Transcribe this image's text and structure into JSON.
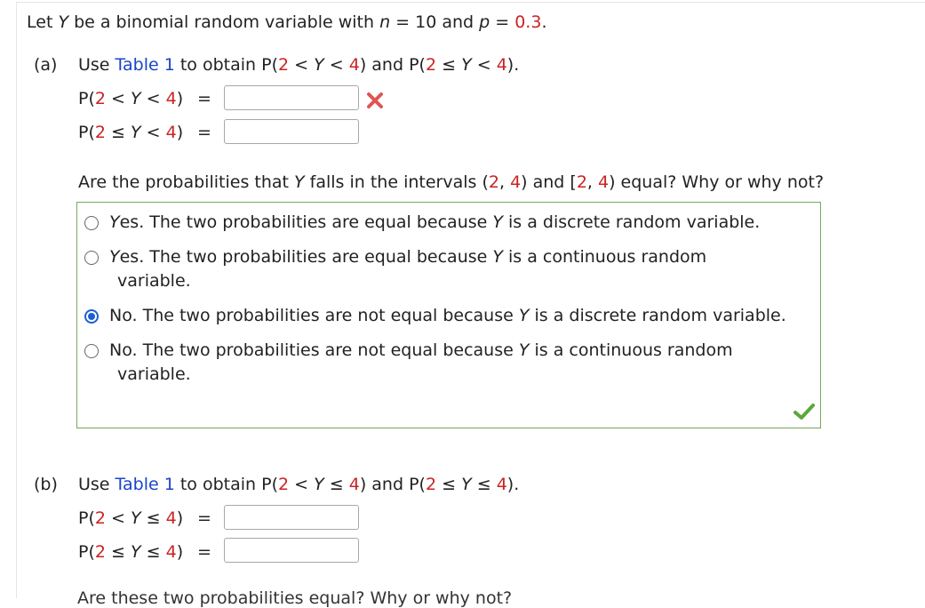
{
  "intro": {
    "t1": "Let ",
    "y": "Y",
    "t2": " be a binomial random variable with ",
    "n": "n",
    "eq1": " = ",
    "n_val": "10",
    "and": " and ",
    "p": "p",
    "eq2": " = ",
    "p_val": "0.3",
    "end": "."
  },
  "part_a": {
    "label": "(a)",
    "use": "Use ",
    "table_link": "Table 1",
    "obtain": " to obtain ",
    "expr1": "P(2 < Y < 4)",
    "and": " and ",
    "expr2": "P(2 ≤ Y < 4)",
    "period": ".",
    "row1": {
      "label": "P(2 < Y < 4)",
      "equals": "=",
      "value": "",
      "status": "incorrect"
    },
    "row2": {
      "label": "P(2 ≤ Y < 4)",
      "equals": "=",
      "value": ""
    },
    "question": "Are the probabilities that Y falls in the intervals (2, 4) and [2, 4) equal? Why or why not?",
    "choices": [
      {
        "text": "Yes. The two probabilities are equal because Y is a discrete random variable.",
        "cont": "",
        "selected": false
      },
      {
        "text": "Yes. The two probabilities are equal because Y is a continuous random",
        "cont": "variable.",
        "selected": false
      },
      {
        "text": "No. The two probabilities are not equal because Y is a discrete random variable.",
        "cont": "",
        "selected": true
      },
      {
        "text": "No. The two probabilities are not equal because Y is a continuous random",
        "cont": "variable.",
        "selected": false
      }
    ],
    "choice_status": "correct"
  },
  "part_b": {
    "label": "(b)",
    "use": "Use ",
    "table_link": "Table 1",
    "obtain": " to obtain ",
    "expr1": "P(2 < Y ≤ 4)",
    "and": " and ",
    "expr2": "P(2 ≤ Y ≤ 4)",
    "period": ".",
    "row1": {
      "label": "P(2 < Y ≤ 4)",
      "equals": "=",
      "value": ""
    },
    "row2": {
      "label": "P(2 ≤ Y ≤ 4)",
      "equals": "=",
      "value": ""
    },
    "next_question": "Are these two probabilities equal? Why or why not?"
  },
  "colors": {
    "number_red": "#cc2222",
    "link_blue": "#1a44cc",
    "incorrect_x": "#e05555",
    "correct_check": "#5aa83a",
    "choice_border": "#73a95a",
    "radio_selected": "#1a5fd6"
  },
  "icons": [
    "x-mark-icon",
    "check-mark-icon"
  ]
}
